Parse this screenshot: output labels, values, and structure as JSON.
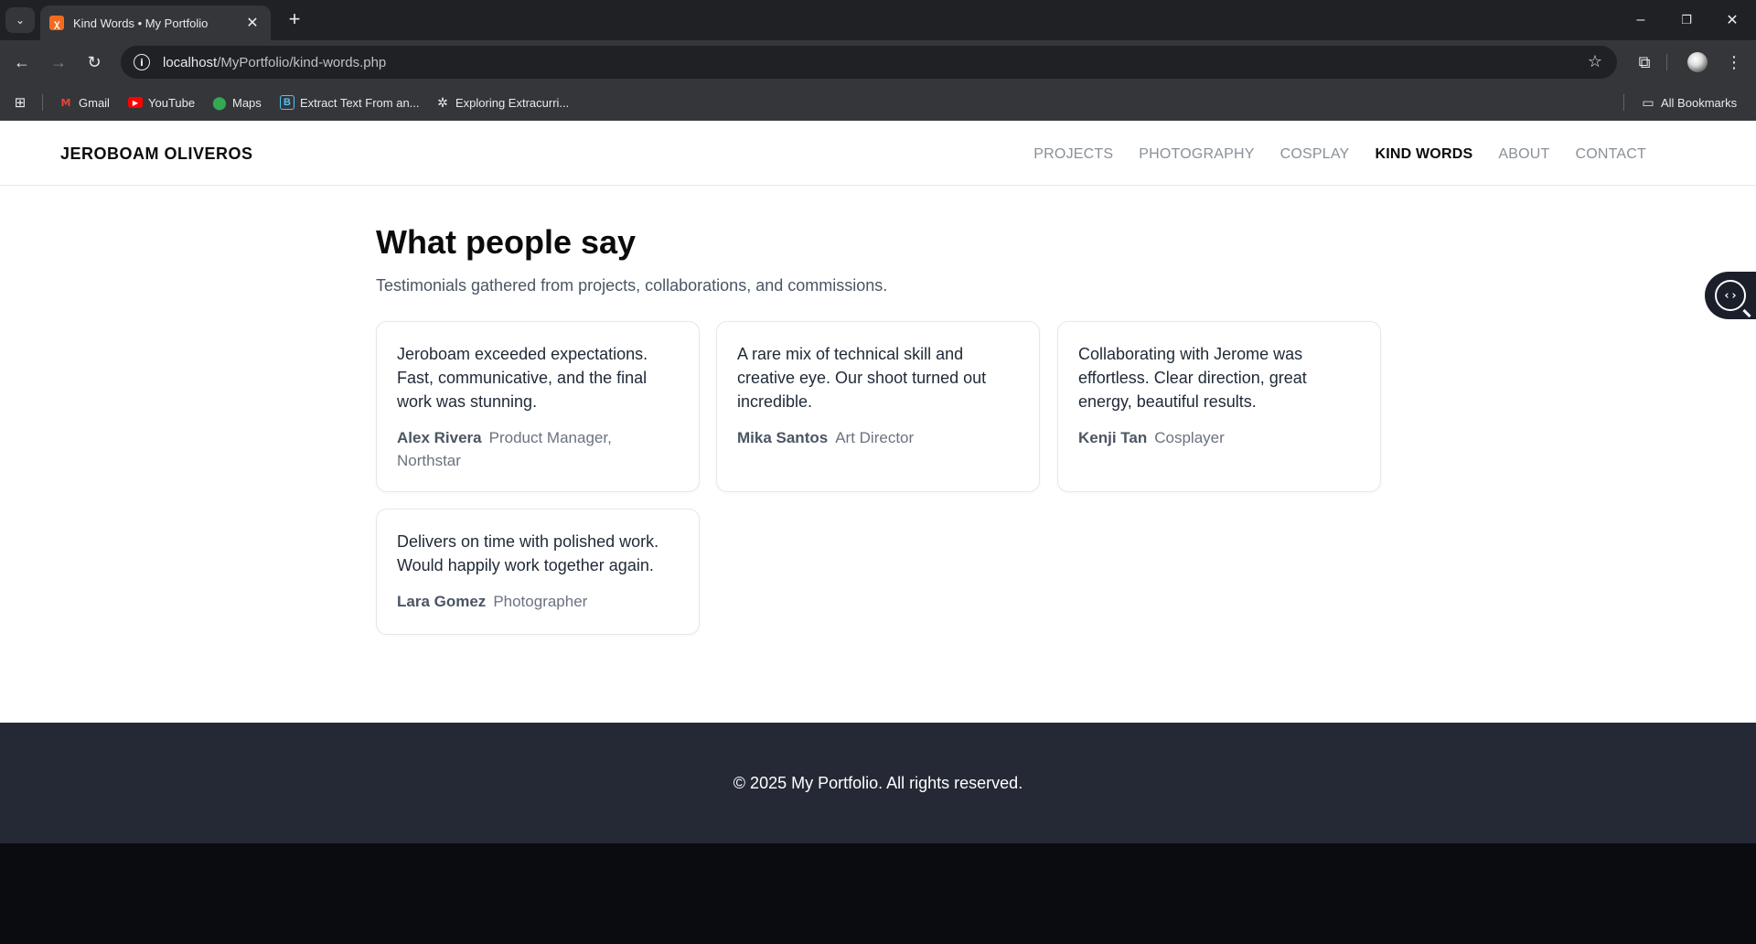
{
  "browser": {
    "tab_title": "Kind Words • My Portfolio",
    "tab_favicon": "xampp-icon",
    "url_host": "localhost",
    "url_path": "/MyPortfolio/kind-words.php",
    "bookmarks": [
      {
        "label": "Gmail",
        "icon": "gmail-icon"
      },
      {
        "label": "YouTube",
        "icon": "youtube-icon"
      },
      {
        "label": "Maps",
        "icon": "maps-icon"
      },
      {
        "label": "Extract Text From an...",
        "icon": "extract-text-icon"
      },
      {
        "label": "Exploring Extracurri...",
        "icon": "chatgpt-icon"
      }
    ],
    "all_bookmarks": "All Bookmarks"
  },
  "site": {
    "brand": "JEROBOAM OLIVEROS",
    "nav": [
      {
        "label": "PROJECTS",
        "active": false
      },
      {
        "label": "PHOTOGRAPHY",
        "active": false
      },
      {
        "label": "COSPLAY",
        "active": false
      },
      {
        "label": "KIND WORDS",
        "active": true
      },
      {
        "label": "ABOUT",
        "active": false
      },
      {
        "label": "CONTACT",
        "active": false
      }
    ]
  },
  "main": {
    "title": "What people say",
    "subtitle": "Testimonials gathered from projects, collaborations, and commissions.",
    "testimonials": [
      {
        "quote": "Jeroboam exceeded expectations. Fast, communicative, and the final work was stunning.",
        "name": "Alex Rivera",
        "role": "Product Manager, Northstar"
      },
      {
        "quote": "A rare mix of technical skill and creative eye. Our shoot turned out incredible.",
        "name": "Mika Santos",
        "role": "Art Director"
      },
      {
        "quote": "Collaborating with Jerome was effortless. Clear direction, great energy, beautiful results.",
        "name": "Kenji Tan",
        "role": "Cosplayer"
      },
      {
        "quote": "Delivers on time with polished work. Would happily work together again.",
        "name": "Lara Gomez",
        "role": "Photographer"
      }
    ]
  },
  "footer": {
    "text": "© 2025 My Portfolio. All rights reserved."
  },
  "colors": {
    "footer_bg": "#252936",
    "nav_active": "#0b0b0b",
    "nav_inactive": "#8a8f98"
  }
}
